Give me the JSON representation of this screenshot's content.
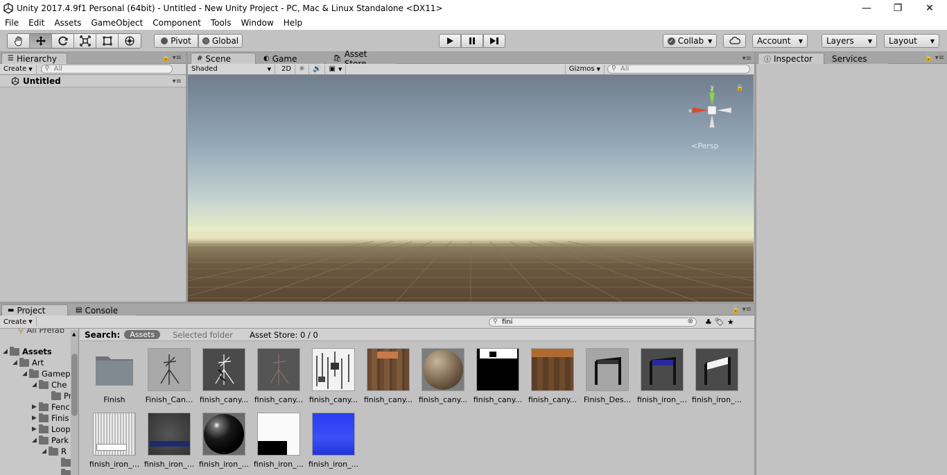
{
  "window": {
    "title": "Unity 2017.4.9f1 Personal (64bit) - Untitled - New Unity Project - PC, Mac & Linux Standalone <DX11>",
    "minimize": "—",
    "maximize": "❐",
    "close": "✕"
  },
  "menu": [
    "File",
    "Edit",
    "Assets",
    "GameObject",
    "Component",
    "Tools",
    "Window",
    "Help"
  ],
  "toolbar": {
    "tools": [
      "hand-tool",
      "move-tool",
      "rotate-tool",
      "scale-tool",
      "rect-tool",
      "transform-tool"
    ],
    "active_tool": "move-tool",
    "pivot": "Pivot",
    "global": "Global",
    "collab": "Collab",
    "account": "Account",
    "layers": "Layers",
    "layout": "Layout"
  },
  "hierarchy": {
    "tab": "Hierarchy",
    "create": "Create",
    "search_placeholder": "All",
    "scene_name": "Untitled"
  },
  "scene": {
    "tabs": [
      "Scene",
      "Game",
      "Asset Store"
    ],
    "shading": "Shaded",
    "mode_2d": "2D",
    "gizmos": "Gizmos",
    "search_placeholder": "All",
    "persp_label": "Persp",
    "axis_x": "x",
    "axis_y": "y"
  },
  "inspector": {
    "tabs": [
      "Inspector",
      "Services"
    ]
  },
  "project": {
    "tabs": [
      "Project",
      "Console"
    ],
    "create": "Create",
    "search_value": "fini",
    "search_label": "Search:",
    "scope_assets": "Assets",
    "scope_selected": "Selected folder",
    "asset_store": "Asset Store: 0 / 0",
    "tree": {
      "partial_top": "All Prefab",
      "items": [
        {
          "label": "Assets",
          "bold": true,
          "expanded": true
        },
        {
          "label": "Art",
          "expanded": true
        },
        {
          "label": "Gamep",
          "expanded": true
        },
        {
          "label": "Che",
          "expanded": true
        },
        {
          "label": "Pr",
          "leaf": true
        },
        {
          "label": "Fenc",
          "expanded": false
        },
        {
          "label": "Finis",
          "expanded": false
        },
        {
          "label": "Loop",
          "expanded": false
        },
        {
          "label": "Park",
          "expanded": true
        },
        {
          "label": "R",
          "expanded": true
        },
        {
          "label": "",
          "leaf": true
        },
        {
          "label": "",
          "leaf": true
        }
      ]
    },
    "assets": [
      {
        "label": "Finish",
        "kind": "folder"
      },
      {
        "label": "Finish_Can...",
        "kind": "model-light"
      },
      {
        "label": "finish_cany...",
        "kind": "model-dark"
      },
      {
        "label": "finish_cany...",
        "kind": "model-dark2"
      },
      {
        "label": "finish_cany...",
        "kind": "tex-white"
      },
      {
        "label": "finish_cany...",
        "kind": "tex-wood"
      },
      {
        "label": "finish_cany...",
        "kind": "sphere-wood"
      },
      {
        "label": "finish_cany...",
        "kind": "tex-black"
      },
      {
        "label": "finish_cany...",
        "kind": "tex-rust"
      },
      {
        "label": "Finish_Des...",
        "kind": "gate-light"
      },
      {
        "label": "finish_iron_...",
        "kind": "gate-blue"
      },
      {
        "label": "finish_iron_...",
        "kind": "gate-white"
      },
      {
        "label": "finish_iron_...",
        "kind": "tex-noise"
      },
      {
        "label": "finish_iron_...",
        "kind": "tex-metal"
      },
      {
        "label": "finish_iron_...",
        "kind": "sphere-black"
      },
      {
        "label": "finish_iron_...",
        "kind": "tex-whiteblack"
      },
      {
        "label": "finish_iron_...",
        "kind": "tex-normal"
      }
    ]
  },
  "colors": {
    "panel_bg": "#c2c2c2",
    "tab_bar": "#a5a5a5",
    "selected_scope": "#6f6f6f"
  }
}
